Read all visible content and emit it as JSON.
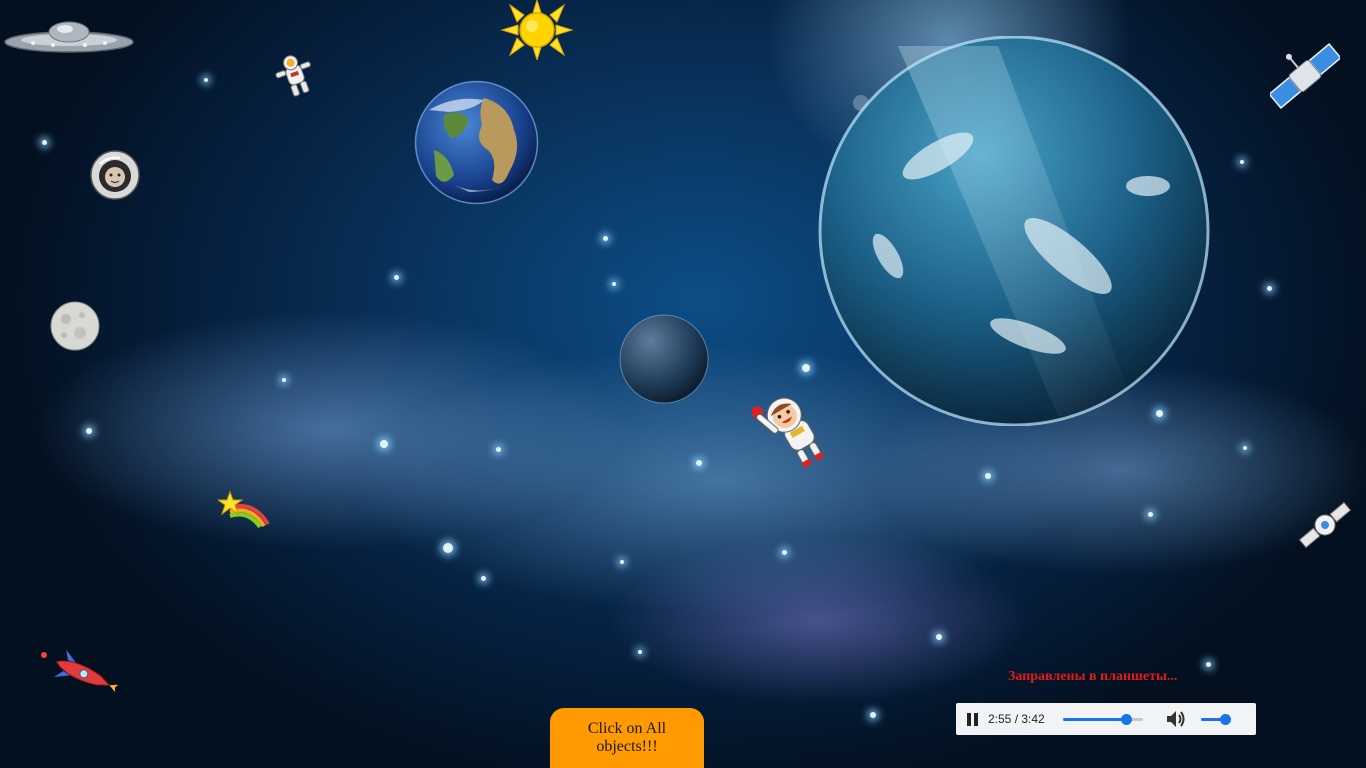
{
  "status_text": "Заправлены в планшеты...",
  "audio_player": {
    "current_time": "2:55",
    "separator": " / ",
    "duration": "3:42",
    "progress_fraction": 0.79,
    "volume_fraction": 0.8
  },
  "cta_button": {
    "label": "Click on All objects!!!"
  },
  "objects": {
    "ufo": "ufo-icon",
    "astronaut": "astronaut-icon",
    "sun": "sun-icon",
    "earth": "earth-planet",
    "cosmonaut_helmet": "cosmonaut-helmet-icon",
    "moon": "moon-icon",
    "dark_planet": "dark-planet",
    "big_planet": "big-blue-planet",
    "cartoon_kid": "cartoon-astronaut-kid",
    "shooting_star": "shooting-star-icon",
    "rocket": "rocket-icon",
    "satellite_top": "satellite-icon",
    "satellite_bottom": "satellite-icon"
  },
  "colors": {
    "status": "#e11a1a",
    "cta_bg": "#ff9a00",
    "player_bg": "#f1f3f4",
    "player_accent": "#1a73e8"
  }
}
